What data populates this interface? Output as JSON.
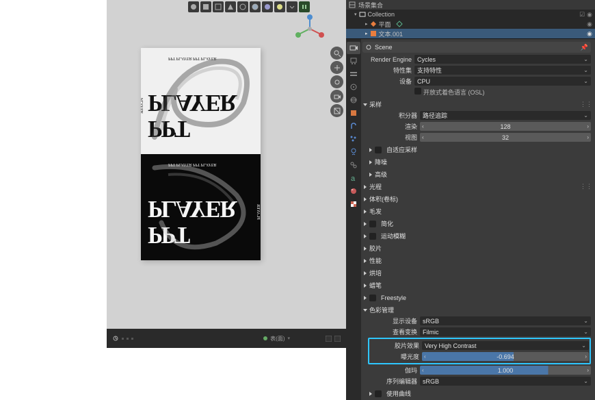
{
  "outliner": {
    "title": "场景集合",
    "items": [
      {
        "label": "Collection",
        "icon": "collection"
      },
      {
        "label": "平面",
        "icon": "mesh",
        "color": "#e87d3e"
      },
      {
        "label": "文本.001",
        "icon": "text",
        "color": "#e87d3e",
        "selected": true
      }
    ]
  },
  "scene_header": "Scene",
  "render": {
    "engine_label": "Render Engine",
    "engine": "Cycles",
    "feature_label": "特性集",
    "feature": "支持特性",
    "device_label": "设备",
    "device": "CPU",
    "osl": "开放式着色语言 (OSL)"
  },
  "sampling": {
    "title": "采样",
    "integrator_label": "积分器",
    "integrator": "路径追踪",
    "render_label": "渲染",
    "render": "128",
    "viewport_label": "视图",
    "viewport": "32"
  },
  "sections": {
    "adaptive": "自适应采样",
    "denoise": "降噪",
    "advanced": "高级",
    "light": "光程",
    "volume": "体积(卷标)",
    "hair": "毛发",
    "simplify": "简化",
    "motion": "运动模糊",
    "film": "胶片",
    "perf": "性能",
    "bake": "烘培",
    "grease": "蜡笔",
    "freestyle": "Freestyle",
    "color": "色彩管理"
  },
  "color_mgmt": {
    "display_device_label": "显示设备",
    "display_device": "sRGB",
    "view_label": "查看变换",
    "view": "Filmic",
    "look_label": "胶片效果",
    "look": "Very High Contrast",
    "exposure_label": "曝光度",
    "exposure": "-0.694",
    "gamma_label": "伽玛",
    "gamma": "1.000",
    "sequencer_label": "序列编辑器",
    "sequencer": "sRGB",
    "curves": "使用曲线"
  },
  "timeline": "表(面)",
  "canvas": {
    "big": "PLAYER",
    "big2": "PPT",
    "side": "PLAYER",
    "small": "PPT PLAYER PPT PLAYER"
  }
}
